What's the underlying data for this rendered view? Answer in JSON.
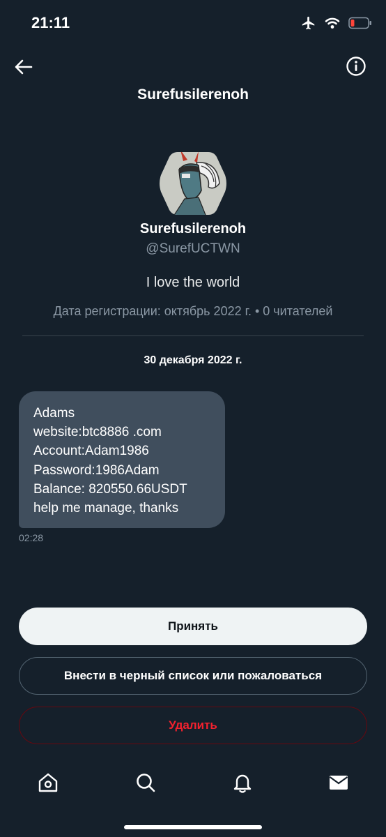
{
  "status_bar": {
    "time": "21:11",
    "icons": [
      "airplane-icon",
      "wifi-icon",
      "battery-low-icon"
    ],
    "battery_color": "#ff453a"
  },
  "header": {
    "title": "Surefusilerenoh",
    "back_icon": "arrow-left-icon",
    "info_icon": "info-circle-icon"
  },
  "profile": {
    "name": "Surefusilerenoh",
    "handle": "@SurefUCTWN",
    "bio": "I love the world",
    "meta": "Дата регистрации: октябрь 2022 г. • 0 читателей"
  },
  "conversation": {
    "date": "30 декабря 2022 г.",
    "messages": [
      {
        "lines": [
          "Adams",
          "website:btc8886 .com",
          "Account:Adam1986",
          "Password:1986Adam",
          "Balance: 820550.66USDT",
          "help me manage, thanks"
        ],
        "time": "02:28"
      }
    ]
  },
  "actions": {
    "accept": "Принять",
    "block": "Внести в черный список или пожаловаться",
    "delete": "Удалить"
  },
  "tab_bar": {
    "icons": [
      "home-icon",
      "search-icon",
      "notifications-bell-icon",
      "messages-envelope-icon"
    ]
  },
  "colors": {
    "background": "#15202b",
    "bubble": "#404e5d",
    "secondary_text": "#8b98a5",
    "delete_red": "#f4212e",
    "accept_bg": "#eff3f4"
  }
}
